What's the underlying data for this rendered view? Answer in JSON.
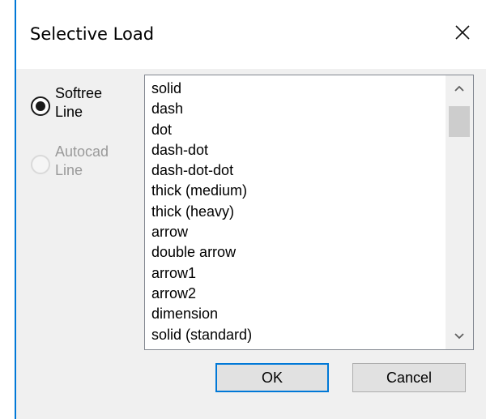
{
  "window": {
    "title": "Selective Load",
    "close_icon": "close-icon"
  },
  "options": [
    {
      "label": "Softree\nLine",
      "line1": "Softree",
      "line2": "Line",
      "checked": true,
      "enabled": true
    },
    {
      "label": "Autocad\nLine",
      "line1": "Autocad",
      "line2": "Line",
      "checked": false,
      "enabled": false
    }
  ],
  "list": {
    "items": [
      "solid",
      "dash",
      "dot",
      "dash-dot",
      "dash-dot-dot",
      "thick (medium)",
      "thick (heavy)",
      "arrow",
      "double arrow",
      "arrow1",
      "arrow2",
      "dimension",
      "solid (standard)"
    ],
    "scroll_up_icon": "chevron-up-icon",
    "scroll_down_icon": "chevron-down-icon"
  },
  "buttons": {
    "ok_label": "OK",
    "cancel_label": "Cancel"
  },
  "colors": {
    "accent": "#0078d7",
    "dialog_bg": "#f0f0f0",
    "disabled_text": "#9a9a9a"
  }
}
